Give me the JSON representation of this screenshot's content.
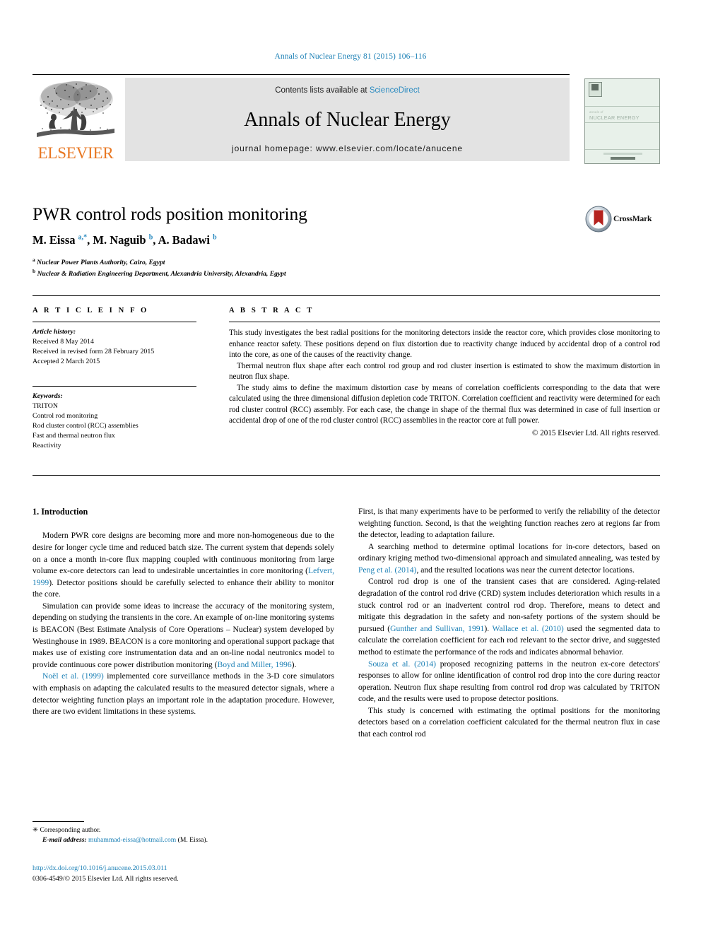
{
  "running_head": "Annals of Nuclear Energy 81 (2015) 106–116",
  "masthead": {
    "contents_prefix": "Contents lists available at ",
    "sciencedirect": "ScienceDirect",
    "journal_title": "Annals of Nuclear Energy",
    "homepage": "journal homepage: www.elsevier.com/locate/anucene",
    "publisher_logo_word": "ELSEVIER",
    "cover_title_small": "annals of",
    "cover_title_big": "NUCLEAR ENERGY"
  },
  "article": {
    "title": "PWR control rods position monitoring",
    "authors_html": "M. Eissa <sup>a,*</sup>, M. Naguib <sup>b</sup>, A. Badawi <sup>b</sup>",
    "affiliation_a": "Nuclear Power Plants Authority, Cairo, Egypt",
    "affiliation_b": "Nuclear & Radiation Engineering Department, Alexandria University, Alexandria, Egypt",
    "crossmark_label": "CrossMark"
  },
  "info": {
    "heading": "A R T I C L E    I N F O",
    "history_label": "Article history:",
    "history": [
      "Received 8 May 2014",
      "Received in revised form 28 February 2015",
      "Accepted 2 March 2015"
    ],
    "keywords_label": "Keywords:",
    "keywords": [
      "TRITON",
      "Control rod monitoring",
      "Rod cluster control (RCC) assemblies",
      "Fast and thermal neutron flux",
      "Reactivity"
    ]
  },
  "abstract": {
    "heading": "A B S T R A C T",
    "p1": "This study investigates the best radial positions for the monitoring detectors inside the reactor core, which provides close monitoring to enhance reactor safety. These positions depend on flux distortion due to reactivity change induced by accidental drop of a control rod into the core, as one of the causes of the reactivity change.",
    "p2": "Thermal neutron flux shape after each control rod group and rod cluster insertion is estimated to show the maximum distortion in neutron flux shape.",
    "p3": "The study aims to define the maximum distortion case by means of correlation coefficients corresponding to the data that were calculated using the three dimensional diffusion depletion code TRITON. Correlation coefficient and reactivity were determined for each rod cluster control (RCC) assembly. For each case, the change in shape of the thermal flux was determined in case of full insertion or accidental drop of one of the rod cluster control (RCC) assemblies in the reactor core at full power.",
    "copyright": "© 2015 Elsevier Ltd. All rights reserved."
  },
  "body": {
    "section_heading": "1. Introduction",
    "left_p1_a": "Modern PWR core designs are becoming more and more non-homogeneous due to the desire for longer cycle time and reduced batch size. The current system that depends solely on a once a month in-core flux mapping coupled with continuous monitoring from large volume ex-core detectors can lead to undesirable uncertainties in core monitoring (",
    "left_p1_cit": "Lefvert, 1999",
    "left_p1_b": "). Detector positions should be carefully selected to enhance their ability to monitor the core.",
    "left_p2_a": "Simulation can provide some ideas to increase the accuracy of the monitoring system, depending on studying the transients in the core. An example of on-line monitoring systems is BEACON (Best Estimate Analysis of Core Operations – Nuclear) system developed by Westinghouse in 1989. BEACON is a core monitoring and operational support package that makes use of existing core instrumentation data and an on-line nodal neutronics model to provide continuous core power distribution monitoring (",
    "left_p2_cit": "Boyd and Miller, 1996",
    "left_p2_b": ").",
    "left_p3_cit": "Noël et al. (1999)",
    "left_p3_a": " implemented core surveillance methods in the 3-D core simulators with emphasis on adapting the calculated results to the measured detector signals, where a detector weighting function plays an important role in the adaptation procedure. However, there are two evident limitations in these systems.",
    "right_p1": "First, is that many experiments have to be performed to verify the reliability of the detector weighting function. Second, is that the weighting function reaches zero at regions far from the detector, leading to adaptation failure.",
    "right_p2_a": "A searching method to determine optimal locations for in-core detectors, based on ordinary kriging method two-dimensional approach and simulated annealing, was tested by ",
    "right_p2_cit": "Peng et al. (2014)",
    "right_p2_b": ", and the resulted locations was near the current detector locations.",
    "right_p3_a": "Control rod drop is one of the transient cases that are considered. Aging-related degradation of the control rod drive (CRD) system includes deterioration which results in a stuck control rod or an inadvertent control rod drop. Therefore, means to detect and mitigate this degradation in the safety and non-safety portions of the system should be pursued (",
    "right_p3_cit1": "Gunther and Sullivan, 1991",
    "right_p3_b": "). ",
    "right_p3_cit2": "Wallace et al. (2010)",
    "right_p3_c": " used the segmented data to calculate the correlation coefficient for each rod relevant to the sector drive, and suggested method to estimate the performance of the rods and indicates abnormal behavior.",
    "right_p4_cit": "Souza et al. (2014)",
    "right_p4_a": " proposed recognizing patterns in the neutron ex-core detectors' responses to allow for online identification of control rod drop into the core during reactor operation. Neutron flux shape resulting from control rod drop was calculated by TRITON code, and the results were used to propose detector positions.",
    "right_p5": "This study is concerned with estimating the optimal positions for the monitoring detectors based on a correlation coefficient calculated for the thermal neutron flux in case that each control rod"
  },
  "footnote": {
    "corresponding": "Corresponding author.",
    "email_label": "E-mail address:",
    "email": "muhammad-eissa@hotmail.com",
    "email_suffix": " (M. Eissa)."
  },
  "bottom": {
    "doi": "http://dx.doi.org/10.1016/j.anucene.2015.03.011",
    "issn_line": "0306-4549/© 2015 Elsevier Ltd. All rights reserved."
  },
  "colors": {
    "link_blue": "#1a7fb5",
    "sciencedirect_blue": "#2b8bc0",
    "elsevier_orange": "#e87722",
    "masthead_gray": "#e3e3e3",
    "crossmark_red": "#b5231f"
  }
}
